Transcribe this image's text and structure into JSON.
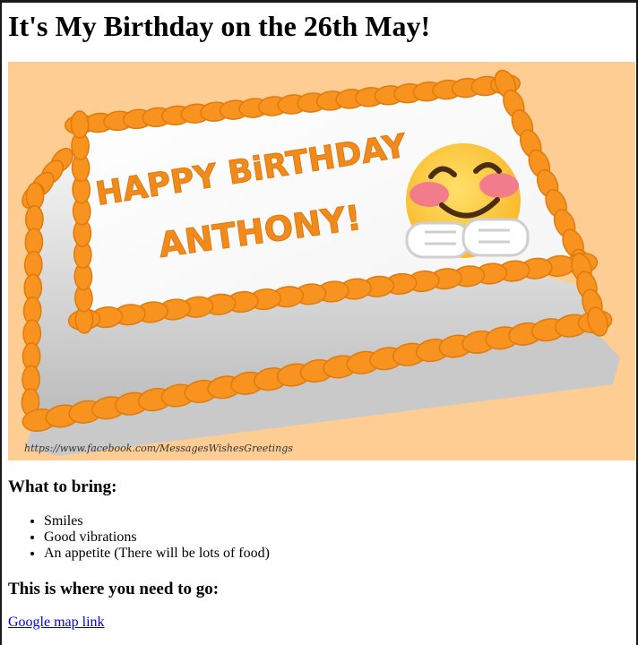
{
  "page": {
    "title": "It's My Birthday on the 26th May!"
  },
  "image": {
    "alt": "Cake with orange frosting reading HAPPY BiRTHDAY ANTHONY! and a hugging emoji",
    "greeting_line1": "HAPPY BiRTHDAY",
    "greeting_line2": "ANTHONY!",
    "watermark": "https://www.facebook.com/MessagesWishesGreetings",
    "colors": {
      "background": "#fdcd93",
      "frosting": "#f7931e",
      "frosting_dark": "#e07a0c",
      "text_orange": "#f08a1c",
      "emoji_yellow": "#fdc93a",
      "emoji_cheek": "#f27c8b",
      "board": "#c9c9c9"
    }
  },
  "bring": {
    "heading": "What to bring:",
    "items": [
      "Smiles",
      "Good vibrations",
      "An appetite (There will be lots of food)"
    ]
  },
  "location": {
    "heading": "This is where you need to go:",
    "link_text": "Google map link"
  }
}
